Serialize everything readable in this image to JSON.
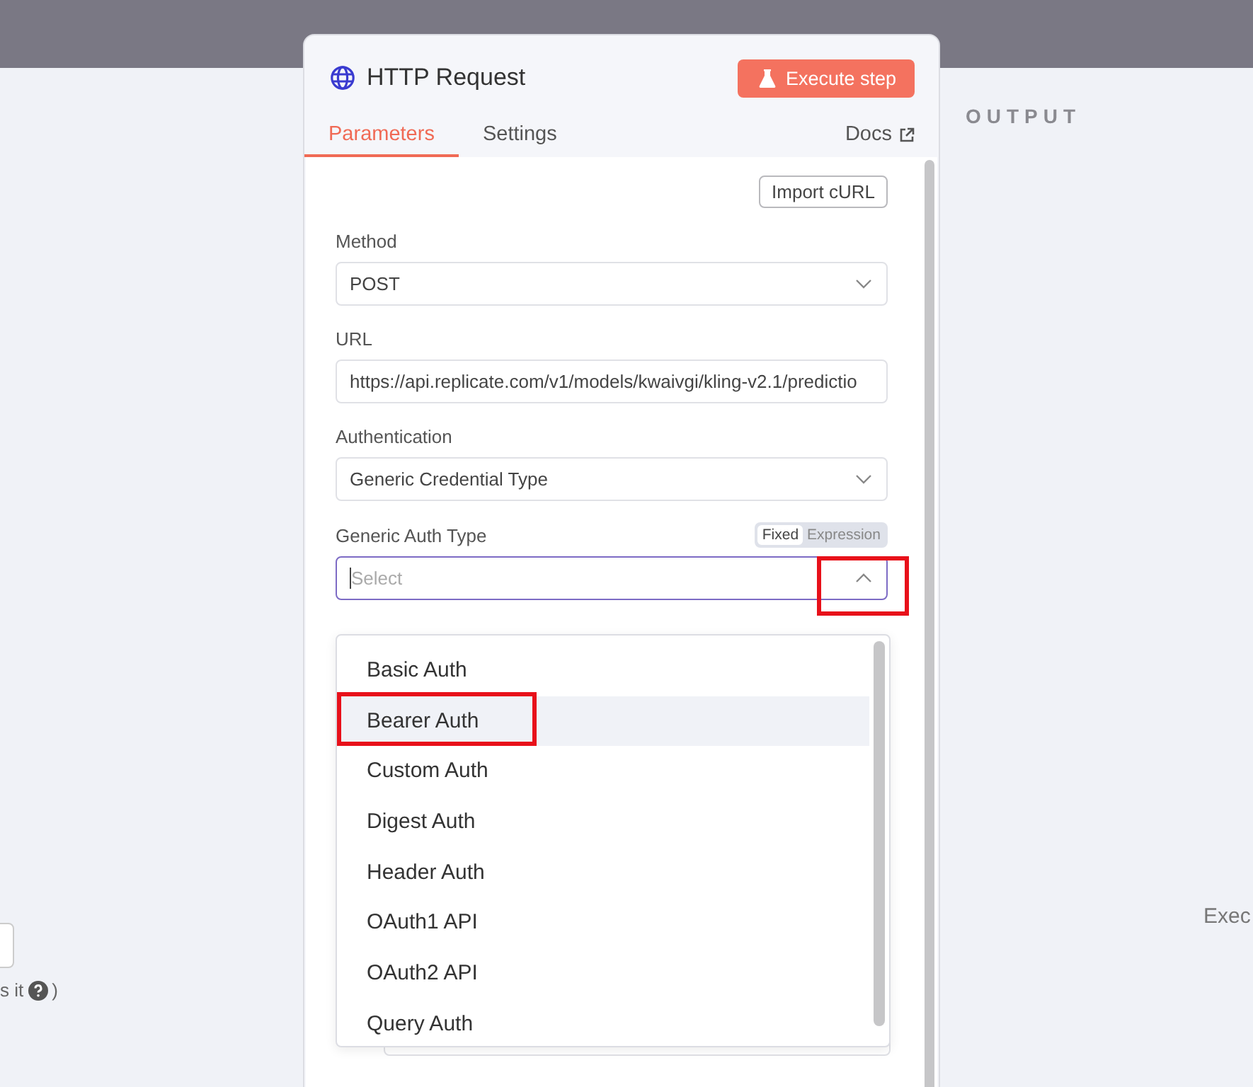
{
  "canvas": {
    "left_fragment": "s it",
    "left_fragment_end": ")",
    "output_label": "OUTPUT",
    "right_fragment": "Exec"
  },
  "panel": {
    "title": "HTTP Request",
    "execute_button": "Execute step",
    "tabs": [
      {
        "label": "Parameters",
        "selected": true
      },
      {
        "label": "Settings",
        "selected": false
      }
    ],
    "docs_link": "Docs",
    "import_button": "Import cURL",
    "fields": [
      {
        "kind": "select",
        "label": "Method",
        "value": "POST"
      },
      {
        "kind": "input",
        "label": "URL",
        "value": "https://api.replicate.com/v1/models/kwaivgi/kling-v2.1/predictio"
      },
      {
        "kind": "select",
        "label": "Authentication",
        "value": "Generic Credential Type"
      }
    ],
    "auth_type": {
      "label": "Generic Auth Type",
      "mode_toggle": [
        {
          "label": "Fixed",
          "selected": true
        },
        {
          "label": "Expression",
          "selected": false
        }
      ],
      "placeholder": "Select",
      "open": true,
      "caret_annotated": true
    },
    "options": [
      {
        "label": "Basic Auth",
        "hovered": false,
        "annotated": false
      },
      {
        "label": "Bearer Auth",
        "hovered": true,
        "annotated": true
      },
      {
        "label": "Custom Auth",
        "hovered": false,
        "annotated": false
      },
      {
        "label": "Digest Auth",
        "hovered": false,
        "annotated": false
      },
      {
        "label": "Header Auth",
        "hovered": false,
        "annotated": false
      },
      {
        "label": "OAuth1 API",
        "hovered": false,
        "annotated": false
      },
      {
        "label": "OAuth2 API",
        "hovered": false,
        "annotated": false
      },
      {
        "label": "Query Auth",
        "hovered": false,
        "annotated": false
      }
    ]
  }
}
